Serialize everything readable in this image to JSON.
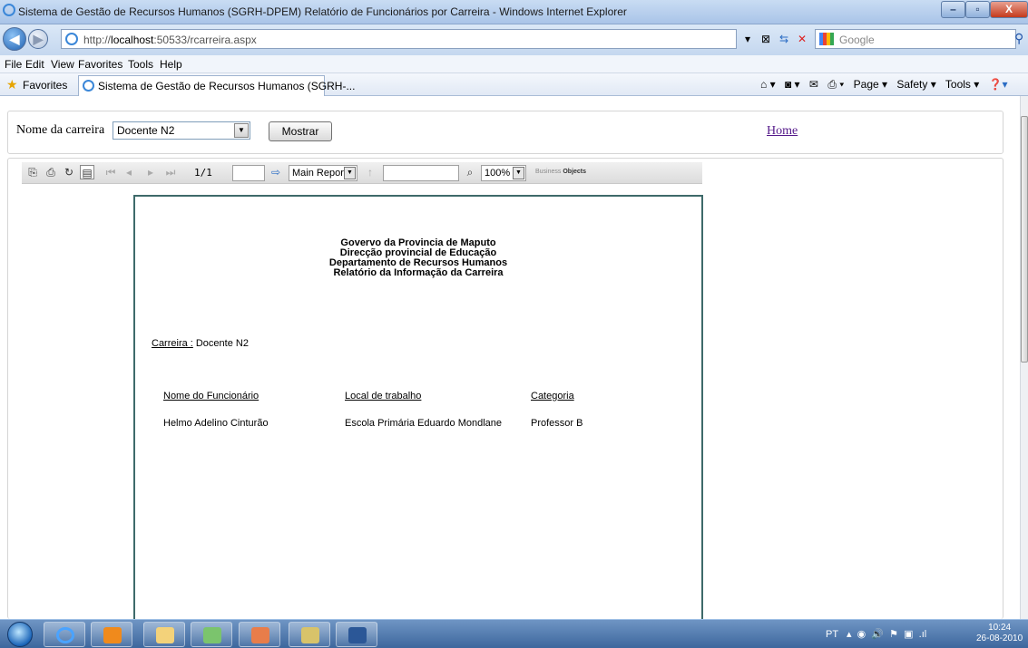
{
  "window": {
    "title": "Sistema de Gestão de Recursos Humanos (SGRH-DPEM) Relatório de Funcionários por Carreira - Windows Internet Explorer",
    "minimize": "–",
    "maximize": "▫",
    "close": "X"
  },
  "address": {
    "url_prefix": "http://",
    "url_host": "localhost",
    "url_rest": ":50533/rcarreira.aspx",
    "search_placeholder": "Google"
  },
  "menu": [
    "File",
    "Edit",
    "View",
    "Favorites",
    "Tools",
    "Help"
  ],
  "favorites": {
    "label": "Favorites",
    "tab_title": "Sistema de Gestão de Recursos Humanos (SGRH-...",
    "commands": [
      "Page ▾",
      "Safety ▾",
      "Tools ▾"
    ]
  },
  "form": {
    "label": "Nome da carreira",
    "select_value": "Docente N2",
    "button": "Mostrar",
    "home_link": "Home"
  },
  "viewer": {
    "page_count": "1/1",
    "report_select": "Main Report",
    "zoom": "100%",
    "logo_prefix": "Business",
    "logo_bold": "Objects"
  },
  "report": {
    "header_lines": [
      "Govervo da Provincia de Maputo",
      "Direcção provincial de Educação",
      "Departamento de Recursos Humanos",
      "Relatório da Informação da Carreira"
    ],
    "carreira_label": "Carreira :",
    "carreira_value": "Docente N2",
    "columns": [
      "Nome do Funcionário",
      "Local de trabalho",
      "Categoria"
    ],
    "rows": [
      [
        "Helmo Adelino Cinturão",
        "Escola Primária Eduardo Mondlane",
        "Professor B"
      ]
    ]
  },
  "taskbar": {
    "language": "PT",
    "time": "10:24",
    "date": "26-08-2010"
  }
}
